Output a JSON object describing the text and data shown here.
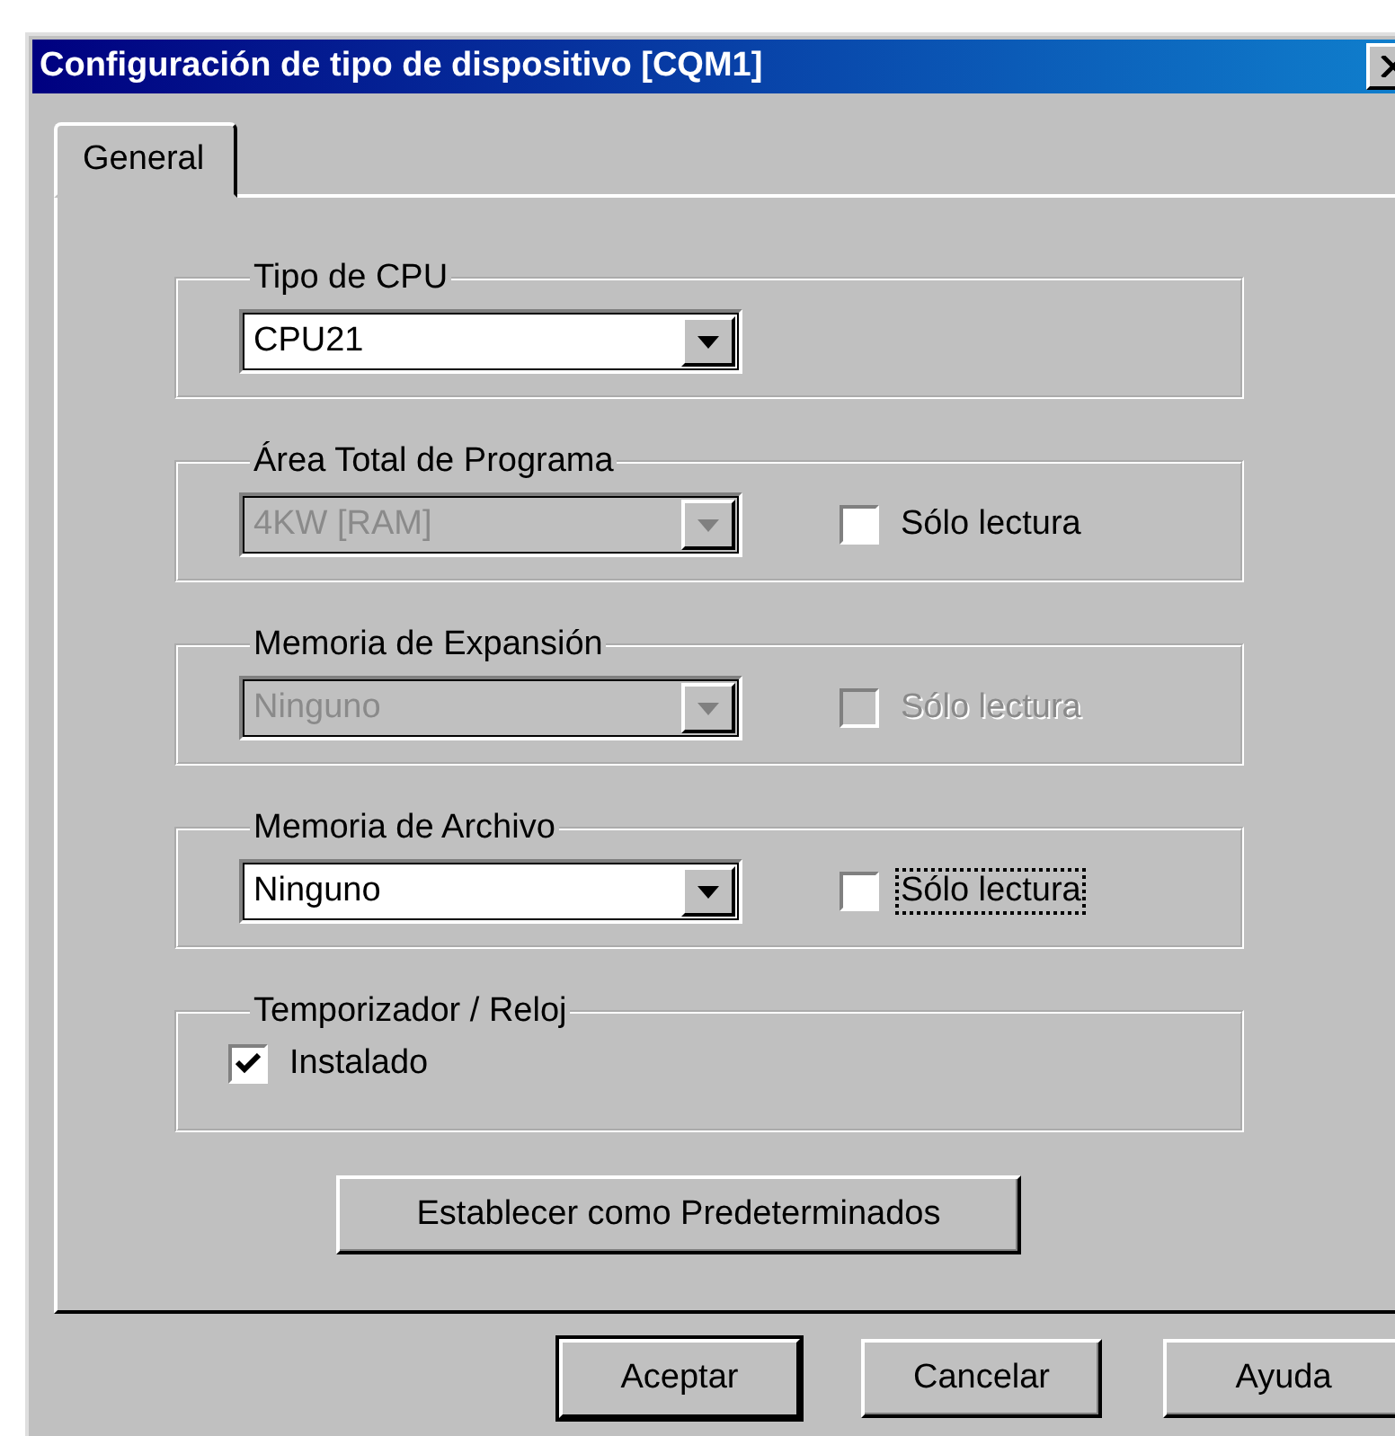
{
  "window": {
    "title": "Configuración de tipo de dispositivo [CQM1]"
  },
  "tabs": [
    {
      "label": "General",
      "selected": true
    }
  ],
  "groups": [
    {
      "title": "Tipo de CPU",
      "dropdown": {
        "value": "CPU21",
        "disabled": false
      }
    },
    {
      "title": "Área Total de Programa",
      "dropdown": {
        "value": "4KW [RAM]",
        "disabled": true
      },
      "checkbox": {
        "label": "Sólo lectura",
        "checked": false,
        "disabled": false,
        "focused": false
      }
    },
    {
      "title": "Memoria de Expansión",
      "dropdown": {
        "value": "Ninguno",
        "disabled": true
      },
      "checkbox": {
        "label": "Sólo lectura",
        "checked": false,
        "disabled": true,
        "focused": false
      }
    },
    {
      "title": "Memoria de Archivo",
      "dropdown": {
        "value": "Ninguno",
        "disabled": false
      },
      "checkbox": {
        "label": "Sólo lectura",
        "checked": false,
        "disabled": false,
        "focused": true
      }
    },
    {
      "title": "Temporizador / Reloj",
      "checkbox": {
        "label": "Instalado",
        "checked": true,
        "disabled": false,
        "focused": false
      }
    }
  ],
  "set_defaults_button": {
    "label": "Establecer como Predeterminados"
  },
  "buttons": [
    {
      "label": "Aceptar",
      "default": true
    },
    {
      "label": "Cancelar",
      "default": false
    },
    {
      "label": "Ayuda",
      "default": false
    }
  ]
}
